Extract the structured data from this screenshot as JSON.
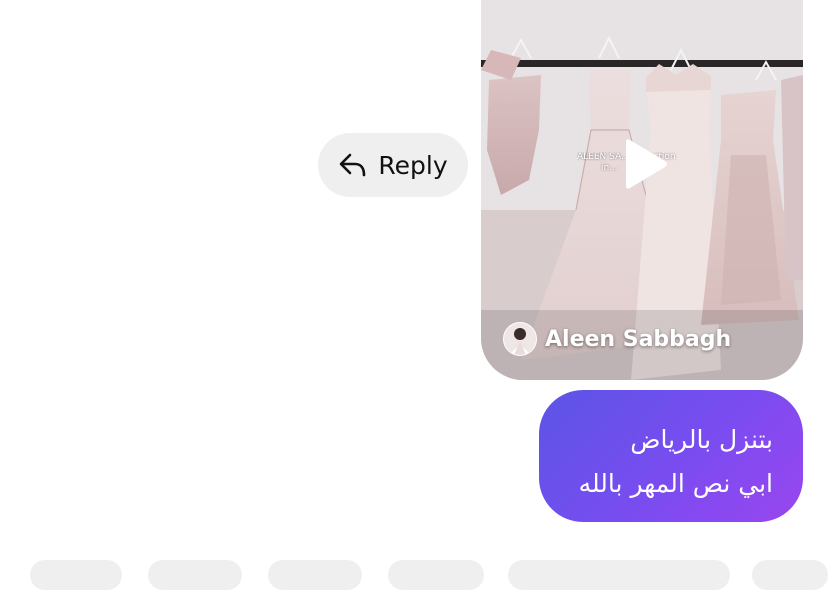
{
  "reply": {
    "label": "Reply",
    "icon": "reply-arrow-icon"
  },
  "shared_video": {
    "author_name": "Aleen Sabbagh",
    "overlay_caption_lines": [
      "ALEEN SA... collection",
      "in..."
    ],
    "play_icon": "play-icon",
    "avatar_icon": "avatar"
  },
  "message": {
    "lines": [
      "بتنزل بالرياض",
      "ابي نص المهر بالله"
    ],
    "gradient_start": "#5b55e6",
    "gradient_end": "#9a46ef"
  },
  "colors": {
    "background": "#ffffff",
    "reply_bg": "#efefef",
    "chip_bg": "#efefef"
  }
}
